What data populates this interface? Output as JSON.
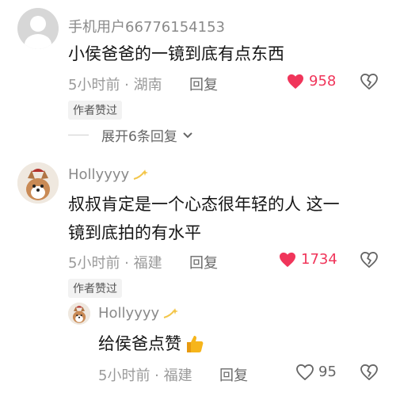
{
  "comments": [
    {
      "username": "手机用户66776154153",
      "text": "小侯爸爸的一镜到底有点东西",
      "time_location": "5小时前 · 湖南",
      "reply_label": "回复",
      "like_count": "958",
      "author_badge": "作者赞过",
      "expand_label": "展开6条回复"
    },
    {
      "username": "Hollyyyy",
      "text_line1": "叔叔肯定是一个心态很年轻的人 这一",
      "text_line2": "镜到底拍的有水平",
      "time_location": "5小时前 · 福建",
      "reply_label": "回复",
      "like_count": "1734",
      "author_badge": "作者赞过"
    },
    {
      "username": "Hollyyyy",
      "text": "给侯爸点赞",
      "time_location": "5小时前 · 福建",
      "reply_label": "回复",
      "like_count": "95"
    }
  ],
  "colors": {
    "liked": "#f0355a",
    "meta": "#9a9a9a"
  },
  "icons": [
    "default-avatar-icon",
    "dog-avatar-icon",
    "sparkle-icon",
    "heart-filled-icon",
    "heart-outline-icon",
    "broken-heart-icon",
    "thumbs-up-icon",
    "chevron-down-icon"
  ]
}
